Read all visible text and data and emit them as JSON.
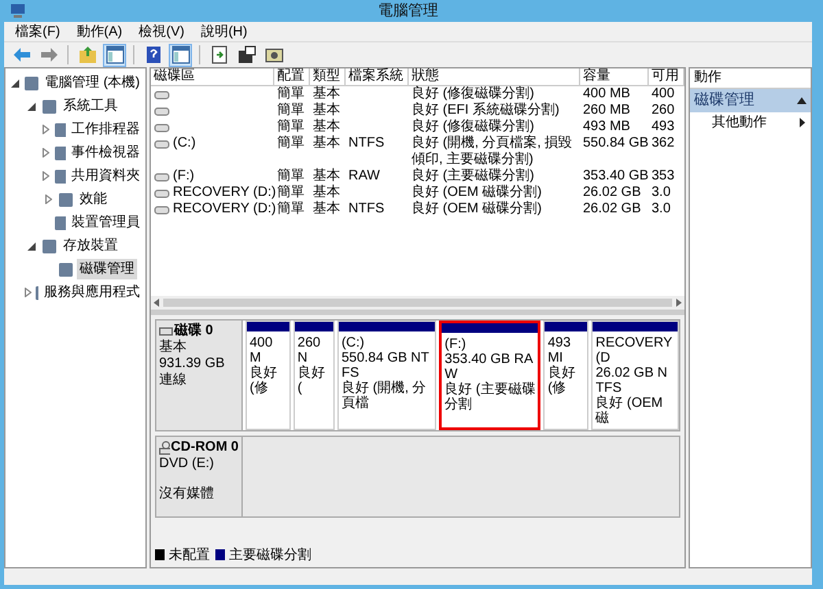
{
  "window": {
    "title": "電腦管理"
  },
  "menu": [
    "檔案(F)",
    "動作(A)",
    "檢視(V)",
    "說明(H)"
  ],
  "toolbar": [
    {
      "kind": "back",
      "pressed": false
    },
    {
      "kind": "forward",
      "pressed": false
    },
    {
      "kind": "sep"
    },
    {
      "kind": "up",
      "pressed": false
    },
    {
      "kind": "pane",
      "pressed": true
    },
    {
      "kind": "sep"
    },
    {
      "kind": "help",
      "pressed": false
    },
    {
      "kind": "pane",
      "pressed": true
    },
    {
      "kind": "sep"
    },
    {
      "kind": "export",
      "pressed": false
    },
    {
      "kind": "props",
      "pressed": false
    },
    {
      "kind": "disk",
      "pressed": false
    }
  ],
  "tree": [
    {
      "label": "電腦管理 (本機)",
      "expanded": true,
      "selected": false,
      "children": [
        {
          "label": "系統工具",
          "expanded": true,
          "selected": false,
          "children": [
            {
              "label": "工作排程器",
              "expanded": false,
              "selected": false
            },
            {
              "label": "事件檢視器",
              "expanded": false,
              "selected": false
            },
            {
              "label": "共用資料夾",
              "expanded": false,
              "selected": false
            },
            {
              "label": "效能",
              "expanded": false,
              "selected": false
            },
            {
              "label": "裝置管理員",
              "selected": false
            }
          ]
        },
        {
          "label": "存放裝置",
          "expanded": true,
          "selected": false,
          "children": [
            {
              "label": "磁碟管理",
              "selected": true
            }
          ]
        },
        {
          "label": "服務與應用程式",
          "expanded": false,
          "selected": false
        }
      ]
    }
  ],
  "table": {
    "columns": [
      "磁碟區",
      "配置",
      "類型",
      "檔案系統",
      "狀態",
      "容量",
      "可用"
    ],
    "rows": [
      [
        "",
        "簡單",
        "基本",
        "",
        "良好 (修復磁碟分割)",
        "400 MB",
        "400"
      ],
      [
        "",
        "簡單",
        "基本",
        "",
        "良好 (EFI 系統磁碟分割)",
        "260 MB",
        "260"
      ],
      [
        "",
        "簡單",
        "基本",
        "",
        "良好 (修復磁碟分割)",
        "493 MB",
        "493"
      ],
      [
        "(C:)",
        "簡單",
        "基本",
        "NTFS",
        "良好 (開機, 分頁檔案, 損毀傾印, 主要磁碟分割)",
        "550.84 GB",
        "362"
      ],
      [
        "(F:)",
        "簡單",
        "基本",
        "RAW",
        "良好 (主要磁碟分割)",
        "353.40 GB",
        "353"
      ],
      [
        "RECOVERY (D:)",
        "簡單",
        "基本",
        "",
        "良好 (OEM 磁碟分割)",
        "26.02 GB",
        "3.0"
      ],
      [
        "RECOVERY (D:)",
        "簡單",
        "基本",
        "NTFS",
        "良好 (OEM 磁碟分割)",
        "26.02 GB",
        "3.0"
      ]
    ]
  },
  "disks": [
    {
      "kind": "disk",
      "name": "磁碟 0",
      "lines": [
        "基本",
        "931.39 GB",
        "連線"
      ],
      "partitions": [
        {
          "lines": [
            "400 M",
            "良好 (修"
          ],
          "highlighted": false
        },
        {
          "lines": [
            "260 N",
            "良好 ("
          ],
          "highlighted": false
        },
        {
          "lines": [
            "(C:)",
            "550.84 GB NTFS",
            "良好 (開機, 分頁檔"
          ],
          "highlighted": false
        },
        {
          "lines": [
            "(F:)",
            "353.40 GB RAW",
            "良好 (主要磁碟分割"
          ],
          "highlighted": true
        },
        {
          "lines": [
            "493 MI",
            "良好 (修"
          ],
          "highlighted": false
        },
        {
          "lines": [
            "RECOVERY (D",
            "26.02 GB NTFS",
            "良好 (OEM 磁"
          ],
          "highlighted": false
        }
      ]
    },
    {
      "kind": "cdrom",
      "name": "CD-ROM 0",
      "lines": [
        "DVD (E:)",
        "沒有媒體"
      ]
    }
  ],
  "legend": [
    {
      "label": "未配置",
      "color": "#000000"
    },
    {
      "label": "主要磁碟分割",
      "color": "#000080"
    }
  ],
  "actions": {
    "header": "動作",
    "sections": [
      {
        "title": "磁碟管理",
        "expanded": true,
        "items": [
          {
            "label": "其他動作",
            "submenu": true
          }
        ]
      }
    ]
  }
}
